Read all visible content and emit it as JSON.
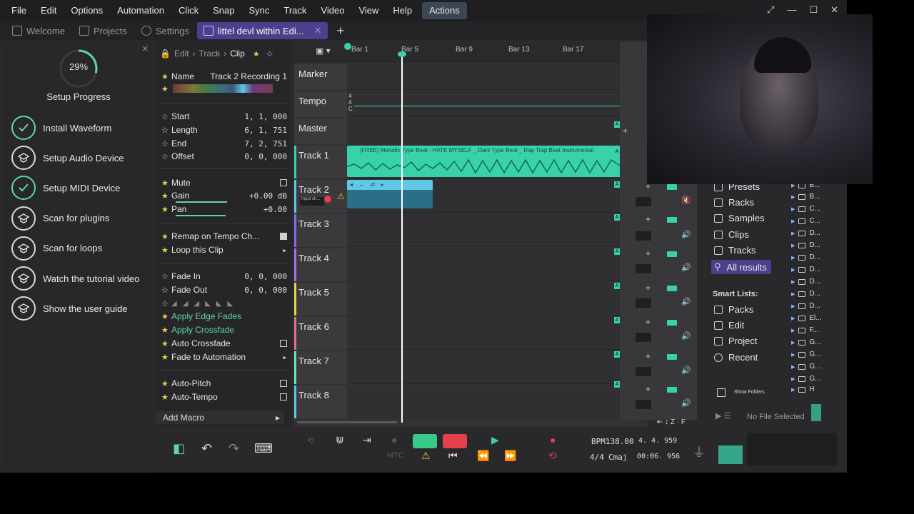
{
  "menubar": {
    "items": [
      "File",
      "Edit",
      "Options",
      "Automation",
      "Click",
      "Snap",
      "Sync",
      "Track",
      "Video",
      "View",
      "Help",
      "Actions"
    ]
  },
  "tabs": [
    {
      "label": "Welcome"
    },
    {
      "label": "Projects"
    },
    {
      "label": "Settings"
    },
    {
      "label": "littel devl within Edi..."
    }
  ],
  "setup": {
    "progress": "29%",
    "progress_fraction": 0.29,
    "title": "Setup Progress",
    "items": [
      {
        "label": "Install Waveform",
        "done": true
      },
      {
        "label": "Setup Audio Device",
        "done": false
      },
      {
        "label": "Setup MIDI Device",
        "done": true
      },
      {
        "label": "Scan for plugins",
        "done": false
      },
      {
        "label": "Scan for loops",
        "done": false
      },
      {
        "label": "Watch the tutorial video",
        "done": false
      },
      {
        "label": "Show the user guide",
        "done": false
      }
    ]
  },
  "inspector": {
    "crumb": {
      "a": "Edit",
      "b": "Track",
      "c": "Clip"
    },
    "name_label": "Name",
    "name_value": "Track 2 Recording 1",
    "start_label": "Start",
    "start_value": "1, 1, 000",
    "length_label": "Length",
    "length_value": "6, 1, 751",
    "end_label": "End",
    "end_value": "7, 2, 751",
    "offset_label": "Offset",
    "offset_value": "0, 0, 000",
    "mute_label": "Mute",
    "gain_label": "Gain",
    "gain_value": "+0.00 dB",
    "pan_label": "Pan",
    "pan_value": "+0.00",
    "remap_label": "Remap on Tempo Ch...",
    "loop_label": "Loop this Clip",
    "fadein_label": "Fade In",
    "fadein_value": "0, 0, 000",
    "fadeout_label": "Fade Out",
    "fadeout_value": "0, 0, 000",
    "apply_edge": "Apply Edge Fades",
    "apply_cross": "Apply Crossfade",
    "auto_cross": "Auto Crossfade",
    "fade_auto": "Fade to Automation",
    "auto_pitch": "Auto-Pitch",
    "auto_tempo": "Auto-Tempo",
    "add_macro": "Add Macro"
  },
  "timeline": {
    "ruler": [
      "Bar 1",
      "Bar 5",
      "Bar 9",
      "Bar 13",
      "Bar 17"
    ],
    "tracks": [
      {
        "label": "Marker"
      },
      {
        "label": "Tempo"
      },
      {
        "label": "Master"
      },
      {
        "label": "Track 1"
      },
      {
        "label": "Track 2"
      },
      {
        "label": "Track 3"
      },
      {
        "label": "Track 4"
      },
      {
        "label": "Track 5"
      },
      {
        "label": "Track 6"
      },
      {
        "label": "Track 7"
      },
      {
        "label": "Track 8"
      }
    ],
    "clip_title": "(FREE) Melodic Type Beat - HATE MYSELF _ Dark Type Beat _ Rap Trap Beat Instrumental",
    "input_label": "Input ch..."
  },
  "browser": {
    "items": [
      "Presets",
      "Racks",
      "Samples",
      "Clips",
      "Tracks",
      "All results"
    ],
    "smart_lists_title": "Smart Lists:",
    "smart_items": [
      "Packs",
      "Edit",
      "Project",
      "Recent"
    ],
    "show_folders": "Show Folders",
    "no_file": "No File Selected",
    "file_rows": [
      "B...",
      "B...",
      "C...",
      "C...",
      "D...",
      "D...",
      "D...",
      "D...",
      "D...",
      "D...",
      "D...",
      "El...",
      "F...",
      "G...",
      "G...",
      "G...",
      "G...",
      "H"
    ]
  },
  "transport": {
    "bpm": "BPM138.00",
    "position": "4. 4. 959",
    "timesig": "4/4",
    "key": "Cmaj",
    "time": "00:06. 956",
    "mtc": "MTC"
  },
  "colors": {
    "accent": "#39d2a8",
    "tab_active": "#4c3f8c",
    "record": "#e2404a"
  }
}
